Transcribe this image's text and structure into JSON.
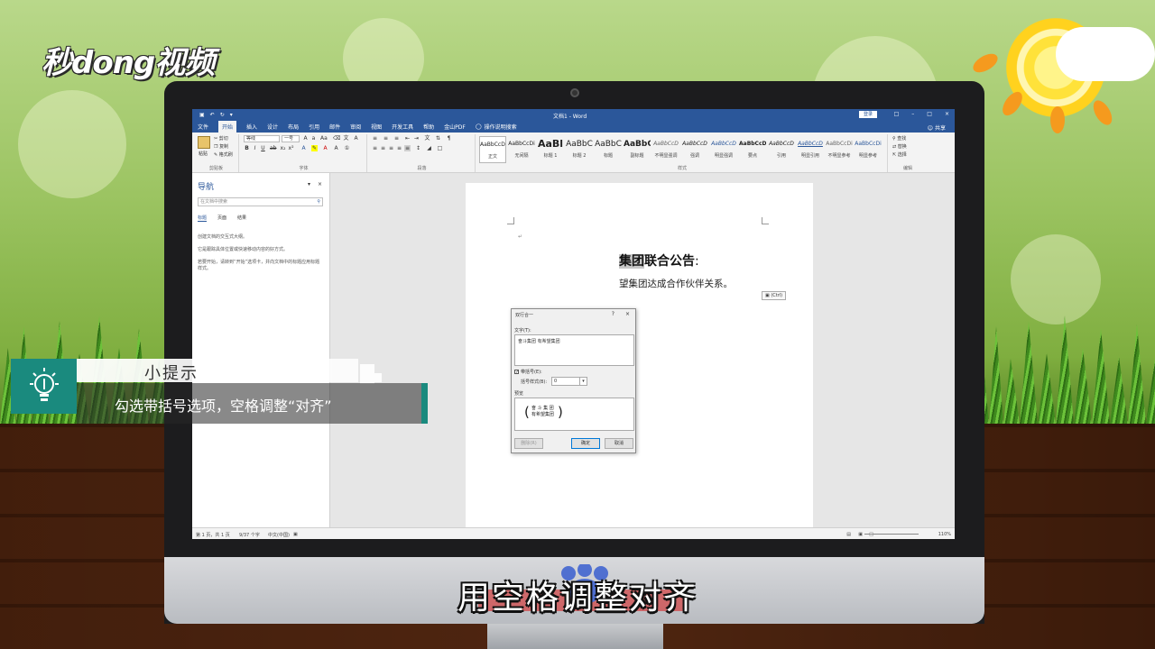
{
  "brand": {
    "logo_text": "秒dong视频"
  },
  "word": {
    "window_title": "文档1 - Word",
    "login_label": "登录",
    "share_label": "共享",
    "menu_tabs": [
      "文件",
      "开始",
      "插入",
      "设计",
      "布局",
      "引用",
      "邮件",
      "审阅",
      "视图",
      "开发工具",
      "帮助",
      "金山PDF",
      "操作说明搜索"
    ],
    "font_name": "等线",
    "font_size": "一号",
    "clipboard": {
      "paste": "粘贴",
      "cut": "剪切",
      "copy": "复制",
      "format_painter": "格式刷",
      "group": "剪贴板"
    },
    "group_labels": {
      "font": "字体",
      "paragraph": "段落",
      "styles": "样式",
      "editing": "编辑"
    },
    "styles": [
      {
        "preview": "AaBbCcDi",
        "name": "正文"
      },
      {
        "preview": "AaBbCcDi",
        "name": "无间隔"
      },
      {
        "preview": "AaBl",
        "name": "标题 1"
      },
      {
        "preview": "AaBbC",
        "name": "标题 2"
      },
      {
        "preview": "AaBbC",
        "name": "标题"
      },
      {
        "preview": "AaBbC",
        "name": "副标题"
      },
      {
        "preview": "AaBbCcD",
        "name": "不明显强调"
      },
      {
        "preview": "AaBbCcD",
        "name": "强调"
      },
      {
        "preview": "AaBbCcD",
        "name": "明显强调"
      },
      {
        "preview": "AaBbCcD",
        "name": "要点"
      },
      {
        "preview": "AaBbCcD",
        "name": "引用"
      },
      {
        "preview": "AaBbCcD",
        "name": "明显引用"
      },
      {
        "preview": "AaBbCcDi",
        "name": "不明显参考"
      },
      {
        "preview": "AaBbCcDi",
        "name": "明显参考"
      }
    ],
    "editing": {
      "find": "查找",
      "replace": "替换",
      "select": "选择"
    },
    "nav": {
      "title": "导航",
      "search_placeholder": "在文档中搜索",
      "tabs": [
        "标题",
        "页面",
        "结果"
      ],
      "text1": "创建文档的交互式大纲。",
      "text2": "它是跟踪具体位置或快速移动内容的好方式。",
      "text3": "若要开始，请转到“开始”选项卡，并向文档中的标题应用标题样式。"
    },
    "doc": {
      "heading_highlight": "集团",
      "heading_rest": "联合公告",
      "heading_tail": ":",
      "body": "望集团达成合作伙伴关系。",
      "paste_label": "(Ctrl)"
    },
    "dialog": {
      "title": "双行合一",
      "help": "?",
      "close": "×",
      "text_label": "文字(T):",
      "text_value": "奋斗集团 有希望集团",
      "checkbox_label": "带括号(E):",
      "checkbox_mark": "✓",
      "bracket_label": "括号样式(B):",
      "bracket_value": "0",
      "preview_label": "预览",
      "preview_line1": "奋 斗 集 团",
      "preview_line2": "有希望集团",
      "paren_open": "(",
      "paren_close": ")",
      "delete_btn": "删除(R)",
      "ok_btn": "确定",
      "cancel_btn": "取消"
    },
    "status": {
      "page": "第 1 页，共 1 页",
      "words": "9/37 个字",
      "lang": "中文(中国)",
      "zoom": "110%"
    }
  },
  "tip": {
    "header": "小提示",
    "body": "勾选带括号选项，空格调整“对齐”"
  },
  "subtitle": "用空格调整对齐",
  "colors": {
    "word_blue": "#2b579a",
    "tip_teal": "#1a8a7e"
  }
}
